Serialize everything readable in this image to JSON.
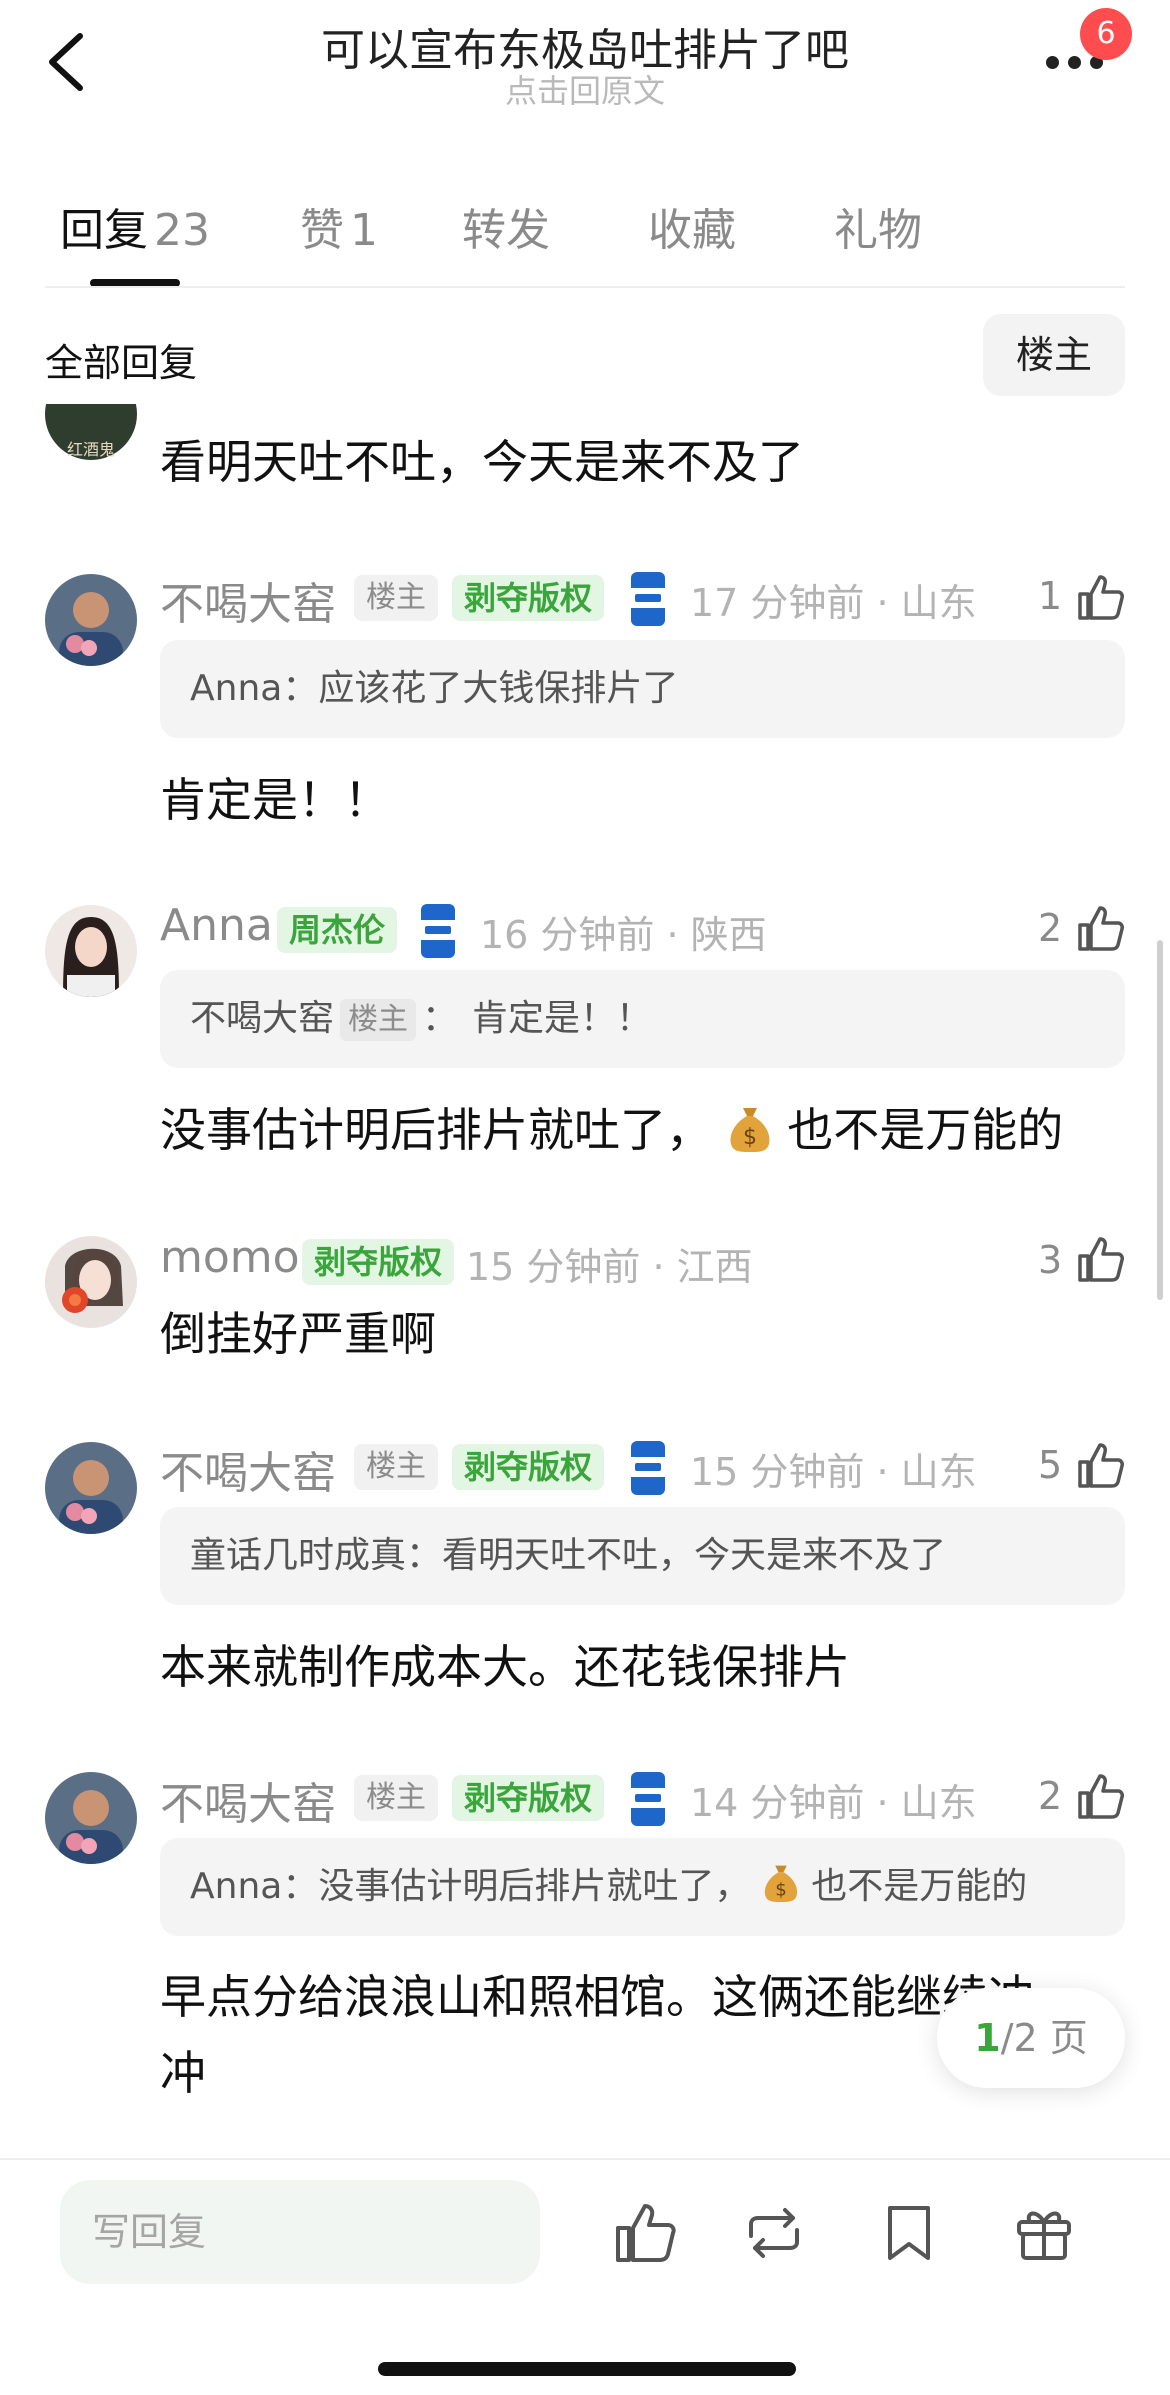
{
  "header": {
    "title": "可以宣布东极岛吐排片了吧",
    "subtitle": "点击回原文",
    "notification_count": "6"
  },
  "tabs": [
    {
      "label": "回复",
      "count": "23"
    },
    {
      "label": "赞",
      "count": "1"
    },
    {
      "label": "转发",
      "count": ""
    },
    {
      "label": "收藏",
      "count": ""
    },
    {
      "label": "礼物",
      "count": ""
    }
  ],
  "filter": {
    "all_replies": "全部回复",
    "owner_only": "楼主"
  },
  "partial_comment": {
    "text": "看明天吐不吐，今天是来不及了",
    "avatar_text": "红酒鬼"
  },
  "comments": [
    {
      "name": "不喝大窑",
      "tag_owner": "楼主",
      "tag_badge": "剥夺版权",
      "meta": "17 分钟前 · 山东",
      "likes": "1",
      "quote_author": "Anna",
      "quote_text": "应该花了大钱保排片了",
      "text": "肯定是！！"
    },
    {
      "name": "Anna",
      "tag_badge": "周杰伦",
      "meta": "16 分钟前 · 陕西",
      "likes": "2",
      "quote_author": "不喝大窑",
      "quote_author_tag": "楼主",
      "quote_text": "肯定是！！",
      "text_before": "没事估计明后排片就吐了，",
      "text_after": "也不是万能的"
    },
    {
      "name": "momo",
      "tag_badge": "剥夺版权",
      "meta": "15 分钟前 · 江西",
      "likes": "3",
      "text": "倒挂好严重啊"
    },
    {
      "name": "不喝大窑",
      "tag_owner": "楼主",
      "tag_badge": "剥夺版权",
      "meta": "15 分钟前 · 山东",
      "likes": "5",
      "quote_author": "童话几时成真",
      "quote_text": "看明天吐不吐，今天是来不及了",
      "text": "本来就制作成本大。还花钱保排片"
    },
    {
      "name": "不喝大窑",
      "tag_owner": "楼主",
      "tag_badge": "剥夺版权",
      "meta": "14 分钟前 · 山东",
      "likes": "2",
      "quote_author": "Anna",
      "quote_text_before": "没事估计明后排片就吐了，",
      "quote_text_after": "也不是万能的",
      "text_line1": "早点分给浪浪山和照相馆。这俩还能继续冲",
      "text_line2": "冲"
    }
  ],
  "pager": {
    "current": "1",
    "total": "/2 页"
  },
  "bottom_bar": {
    "placeholder": "写回复"
  },
  "colors": {
    "accent_green": "#3aa53a",
    "badge_red": "#ff4d4f"
  }
}
